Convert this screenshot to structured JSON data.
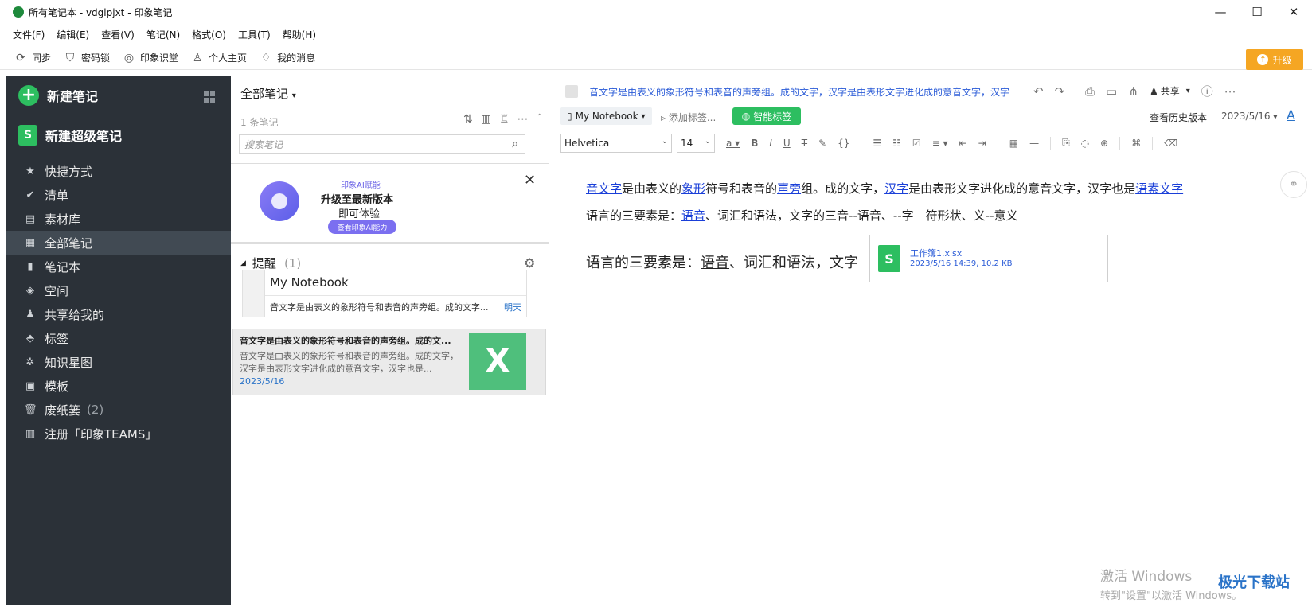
{
  "window": {
    "title": "所有笔记本 - vdglpjxt - 印象笔记",
    "minimize": "—",
    "maximize": "☐",
    "close": "✕"
  },
  "menu": [
    "文件(F)",
    "编辑(E)",
    "查看(V)",
    "笔记(N)",
    "格式(O)",
    "工具(T)",
    "帮助(H)"
  ],
  "toolbar": {
    "items": [
      {
        "label": "同步",
        "icon": "sync-icon"
      },
      {
        "label": "密码锁",
        "icon": "shield-lock-icon"
      },
      {
        "label": "印象识堂",
        "icon": "target-icon"
      },
      {
        "label": "个人主页",
        "icon": "user-icon"
      },
      {
        "label": "我的消息",
        "icon": "bell-icon"
      }
    ],
    "upgrade": "升级",
    "accent": "#f5a623"
  },
  "sidebar": {
    "new_note": "新建笔记",
    "new_super": "新建超级笔记",
    "items": [
      {
        "label": "快捷方式",
        "icon": "star-icon",
        "count": ""
      },
      {
        "label": "清单",
        "icon": "check-circle-icon",
        "count": ""
      },
      {
        "label": "素材库",
        "icon": "stack-icon",
        "count": ""
      },
      {
        "label": "全部笔记",
        "icon": "note-icon",
        "count": ""
      },
      {
        "label": "笔记本",
        "icon": "notebook-icon",
        "count": ""
      },
      {
        "label": "空间",
        "icon": "cube-icon",
        "count": ""
      },
      {
        "label": "共享给我的",
        "icon": "people-icon",
        "count": ""
      },
      {
        "label": "标签",
        "icon": "tag-icon",
        "count": ""
      },
      {
        "label": "知识星图",
        "icon": "graph-icon",
        "count": ""
      },
      {
        "label": "模板",
        "icon": "template-icon",
        "count": ""
      },
      {
        "label": "废纸篓",
        "icon": "trash-icon",
        "count": "(2)"
      },
      {
        "label": "注册「印象TEAMS」",
        "icon": "building-icon",
        "count": ""
      }
    ],
    "active_index": 3,
    "bg": "#2b3138",
    "accent": "#2dbe60"
  },
  "notelist": {
    "header": "全部笔记",
    "count": "1 条笔记",
    "search_placeholder": "搜索笔记",
    "promo": {
      "small": "印象AI赋能",
      "title": "升级至最新版本",
      "sub": "即可体验",
      "button": "查看印象AI能力"
    },
    "reminder": {
      "label": "提醒",
      "count": "(1)",
      "notebook": "My Notebook",
      "text": "音文字是由表义的象形符号和表音的声旁组。成的文字...",
      "due": "明天"
    },
    "note": {
      "title": "音文字是由表义的象形符号和表音的声旁组。成的文...",
      "snippet": "音文字是由表义的象形符号和表音的声旁组。成的文字，汉字是由表形文字进化成的意音文字，汉字也是...",
      "date": "2023/5/16",
      "thumb": "X"
    }
  },
  "editor": {
    "title": "音文字是由表义的象形符号和表音的声旁组。成的文字，汉字是由表形文字进化成的意音文字，汉字",
    "share": "共享",
    "notebook": "My Notebook",
    "add_tag": "添加标签...",
    "smart_tag": "智能标签",
    "history": "查看历史版本",
    "date": "2023/5/16",
    "font": "Helvetica",
    "size": "14",
    "body": {
      "l1_a": "音文字",
      "l1_b": "是由表义的",
      "l1_c": "象形",
      "l1_d": "符号和表音的",
      "l1_e": "声旁",
      "l1_f": "组。成的文字，",
      "l1_g": "汉字",
      "l1_h": "是由表形文字进化成的意音文字，汉字也是",
      "l1_i": "语素文字",
      "l2_a": "语言的三要素是：",
      "l2_b": "语音",
      "l2_c": "、词汇和语法，文字的三音--语音、--字　符形状、义--意义",
      "l3_a": "语言的三要素是：",
      "l3_b": "语音",
      "l3_c": "、词汇和语法，文字"
    },
    "attachment": {
      "name": "工作簿1.xlsx",
      "meta": "2023/5/16 14:39, 10.2 KB",
      "icon": "S"
    }
  },
  "watermark": {
    "line1": "激活 Windows",
    "line2": "转到\"设置\"以激活 Windows。",
    "logo": "极光下载站"
  }
}
